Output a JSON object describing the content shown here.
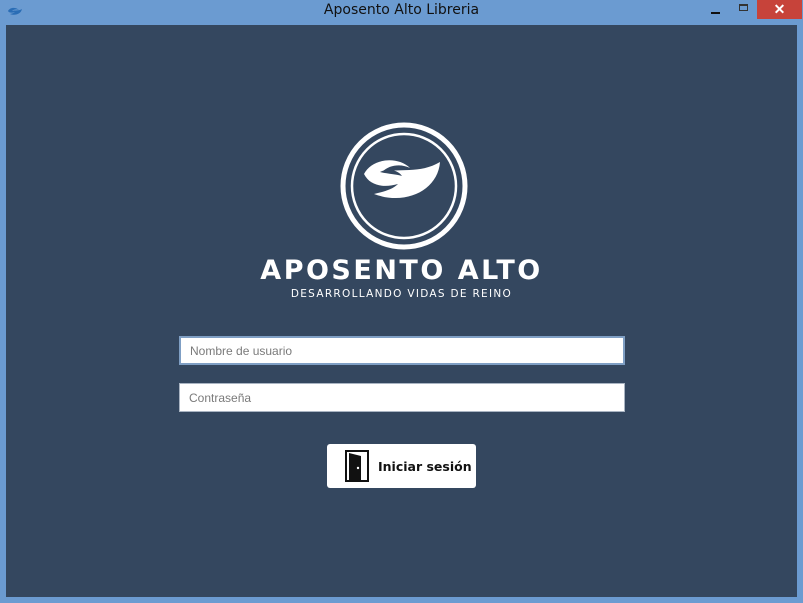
{
  "window": {
    "title": "Aposento Alto Libreria",
    "close_glyph": "✕"
  },
  "brand": {
    "name": "APOSENTO ALTO",
    "tagline": "DESARROLLANDO VIDAS DE REINO"
  },
  "login": {
    "username_placeholder": "Nombre de usuario",
    "username_value": "",
    "password_placeholder": "Contraseña",
    "password_value": "",
    "submit_label": "Iniciar sesión"
  },
  "icons": {
    "app": "dove-icon",
    "logo": "dove-logo-icon",
    "login": "door-icon"
  },
  "colors": {
    "background": "#34475f",
    "window_frame": "#6b9bd1",
    "close_button": "#c7433a",
    "text_light": "#ffffff"
  }
}
